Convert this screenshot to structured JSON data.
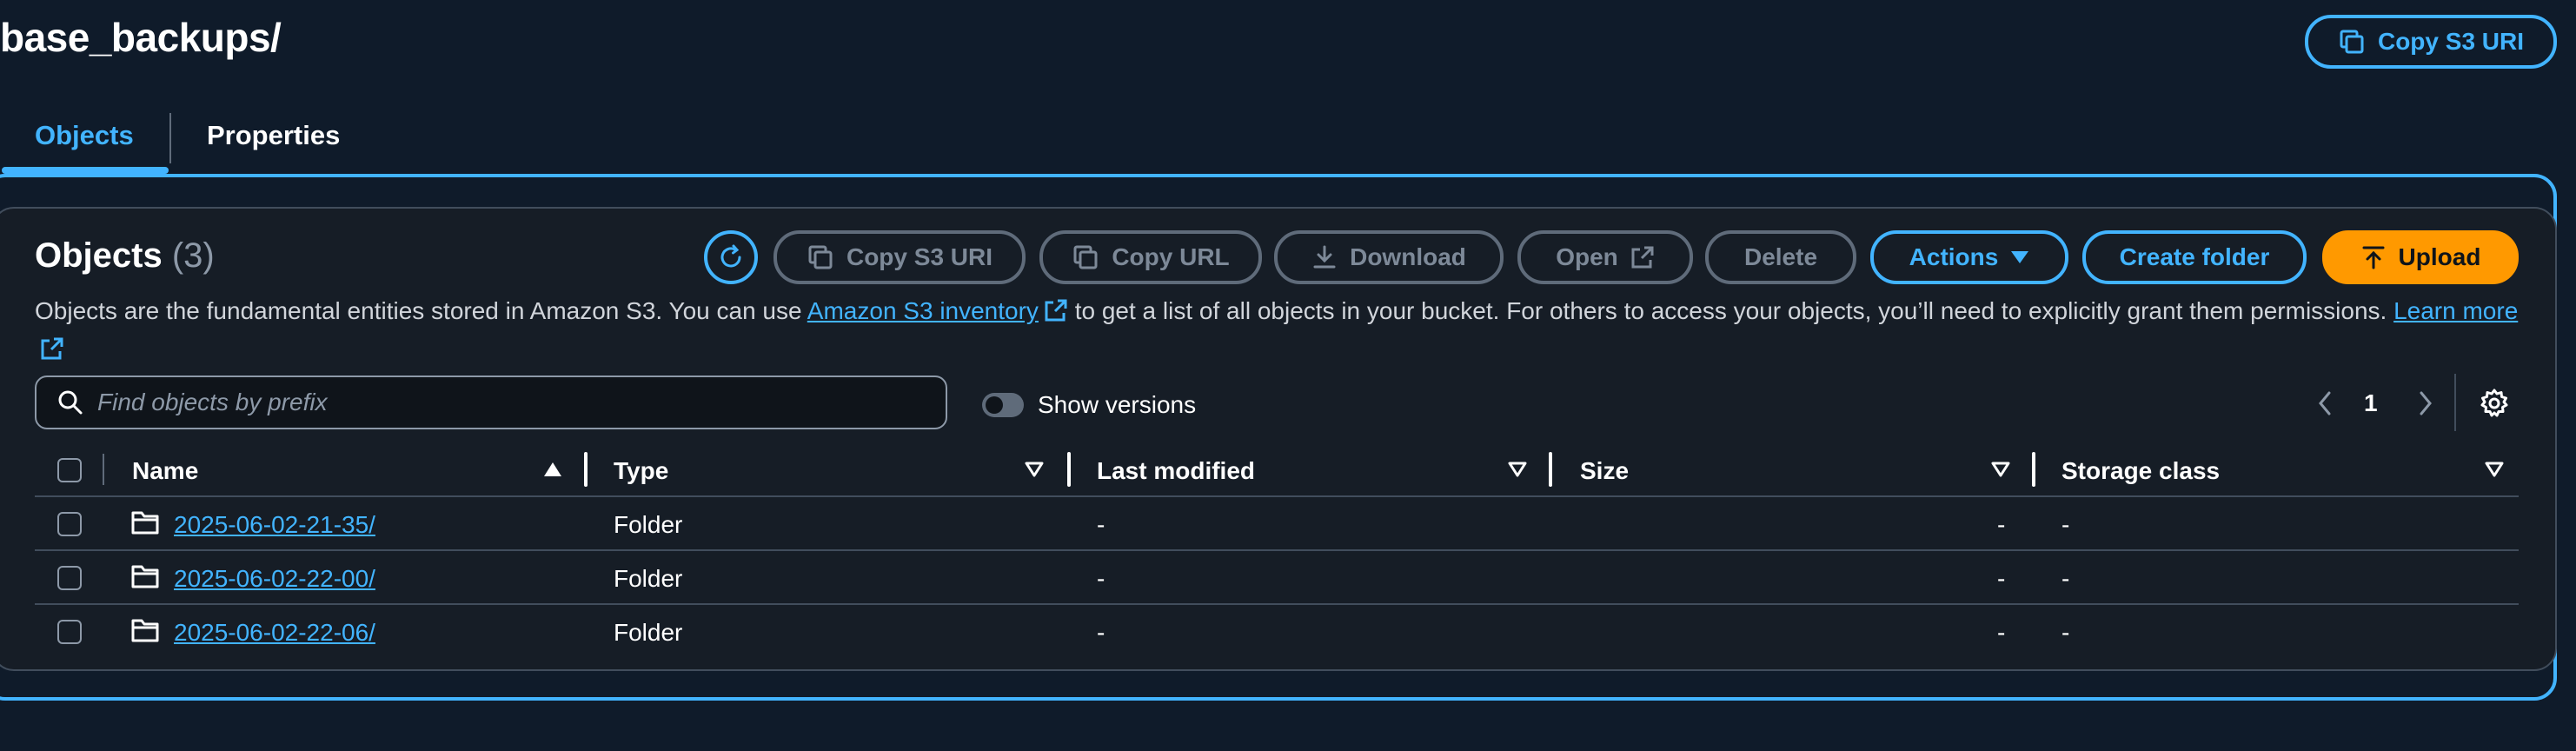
{
  "page": {
    "title": "base_backups/",
    "copy_s3_uri_label": "Copy S3 URI"
  },
  "tabs": [
    {
      "label": "Objects",
      "active": true
    },
    {
      "label": "Properties",
      "active": false
    }
  ],
  "objects_panel": {
    "title": "Objects",
    "count": "(3)",
    "toolbar": {
      "copy_s3_uri": "Copy S3 URI",
      "copy_url": "Copy URL",
      "download": "Download",
      "open": "Open",
      "delete": "Delete",
      "actions": "Actions",
      "create_folder": "Create folder",
      "upload": "Upload"
    },
    "description": {
      "part1": "Objects are the fundamental entities stored in Amazon S3. You can use ",
      "link1": "Amazon S3 inventory",
      "part2": " to get a list of all objects in your bucket. For others to access your objects, you’ll need to explicitly grant them permissions. ",
      "link2": "Learn more"
    },
    "search": {
      "placeholder": "Find objects by prefix",
      "value": ""
    },
    "show_versions": {
      "label": "Show versions",
      "enabled": false
    },
    "pagination": {
      "current_page": "1"
    },
    "columns": [
      "Name",
      "Type",
      "Last modified",
      "Size",
      "Storage class"
    ],
    "rows": [
      {
        "name": "2025-06-02-21-35/",
        "type": "Folder",
        "last_modified": "-",
        "size": "-",
        "storage_class": "-"
      },
      {
        "name": "2025-06-02-22-00/",
        "type": "Folder",
        "last_modified": "-",
        "size": "-",
        "storage_class": "-"
      },
      {
        "name": "2025-06-02-22-06/",
        "type": "Folder",
        "last_modified": "-",
        "size": "-",
        "storage_class": "-"
      }
    ]
  },
  "colors": {
    "background": "#0f1b2a",
    "accent_blue": "#42b4ff",
    "primary_orange": "#ff9900",
    "disabled": "#7d8998"
  },
  "icons": [
    "copy-icon",
    "refresh-icon",
    "download-icon",
    "external-link-icon",
    "caret-down-icon",
    "arrow-up-icon",
    "search-icon",
    "chevron-left-icon",
    "chevron-right-icon",
    "gear-icon",
    "folder-icon",
    "sort-ascending-icon",
    "sort-descending-icon"
  ]
}
